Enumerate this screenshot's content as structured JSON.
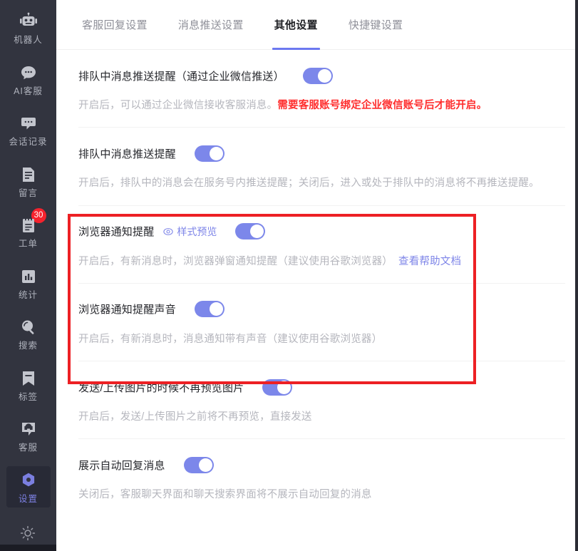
{
  "sidebar": {
    "items": [
      {
        "label": "机器人",
        "icon": "robot-icon",
        "badge": null,
        "active": false
      },
      {
        "label": "AI客服",
        "icon": "chat-bubble-icon",
        "badge": null,
        "active": false
      },
      {
        "label": "会话记录",
        "icon": "message-dots-icon",
        "badge": null,
        "active": false
      },
      {
        "label": "留言",
        "icon": "document-lines-icon",
        "badge": null,
        "active": false
      },
      {
        "label": "工单",
        "icon": "clipboard-icon",
        "badge": "30",
        "active": false
      },
      {
        "label": "统计",
        "icon": "bar-chart-icon",
        "badge": null,
        "active": false
      },
      {
        "label": "搜索",
        "icon": "search-icon",
        "badge": null,
        "active": false
      },
      {
        "label": "标签",
        "icon": "bookmark-icon",
        "badge": null,
        "active": false
      },
      {
        "label": "客服",
        "icon": "headset-icon",
        "badge": null,
        "active": false
      },
      {
        "label": "设置",
        "icon": "gear-hex-icon",
        "badge": null,
        "active": true
      }
    ],
    "footer_icon": "brightness-sun-icon",
    "active_color": "#7B7FE0",
    "background": "#32343F"
  },
  "tabs": [
    {
      "label": "客服回复设置",
      "active": false
    },
    {
      "label": "消息推送设置",
      "active": false
    },
    {
      "label": "其他设置",
      "active": true
    },
    {
      "label": "快捷键设置",
      "active": false
    }
  ],
  "tab_accent_color": "#6C78F0",
  "settings": [
    {
      "title": "排队中消息推送提醒（通过企业微信推送）",
      "toggle_on": true,
      "desc": "开启后，可以通过企业微信接收客服消息。",
      "warn": "需要客服账号绑定企业微信账号后才能开启。",
      "preview_link": null,
      "doc_link": null
    },
    {
      "title": "排队中消息推送提醒",
      "toggle_on": true,
      "desc": "开启后，排队中的消息会在服务号内推送提醒；关闭后，进入或处于排队中的消息将不再推送提醒。",
      "warn": null,
      "preview_link": null,
      "doc_link": null
    },
    {
      "title": "浏览器通知提醒",
      "toggle_on": true,
      "desc": "开启后，有新消息时，浏览器弹窗通知提醒（建议使用谷歌浏览器）",
      "warn": null,
      "preview_link": "样式预览",
      "doc_link": "查看帮助文档"
    },
    {
      "title": "浏览器通知提醒声音",
      "toggle_on": true,
      "desc": "开启后，有新消息时，消息通知带有声音（建议使用谷歌浏览器）",
      "warn": null,
      "preview_link": null,
      "doc_link": null
    },
    {
      "title": "发送/上传图片的时候不再预览图片",
      "toggle_on": true,
      "desc": "开启后，发送/上传图片之前将不再预览，直接发送",
      "warn": null,
      "preview_link": null,
      "doc_link": null
    },
    {
      "title": "展示自动回复消息",
      "toggle_on": true,
      "desc": "关闭后，客服聊天界面和聊天搜索界面将不展示自动回复的消息",
      "warn": null,
      "preview_link": null,
      "doc_link": null
    }
  ],
  "annotation": {
    "type": "red-rectangle-highlight",
    "color": "#ED2024"
  }
}
